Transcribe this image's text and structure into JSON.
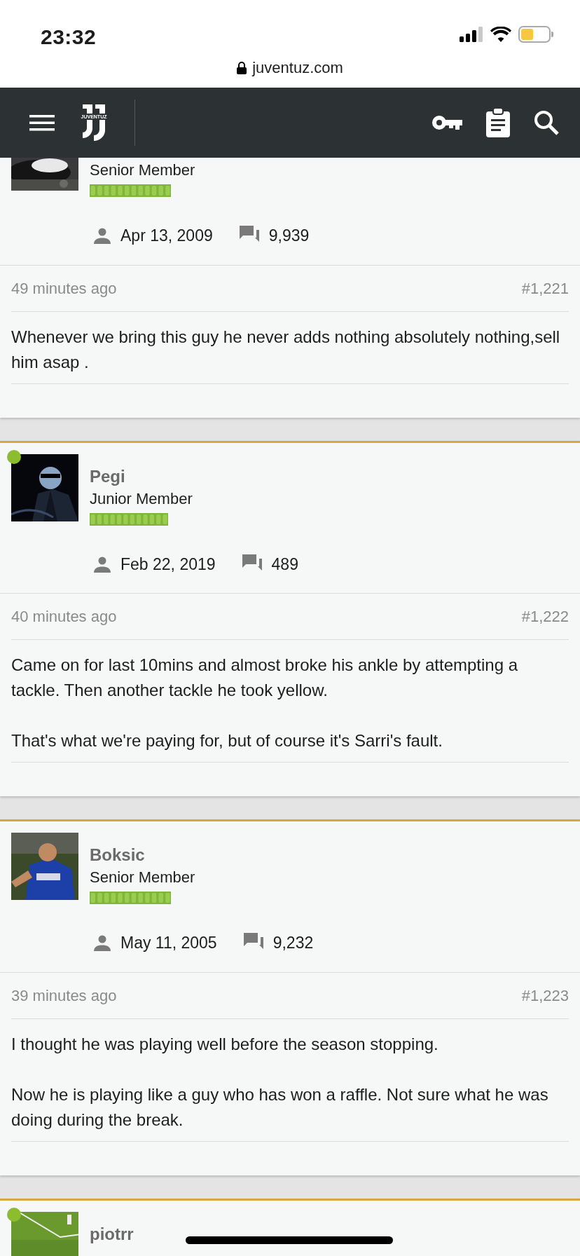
{
  "status_bar": {
    "time": "23:32"
  },
  "address_bar": {
    "url": "juventuz.com"
  },
  "navbar": {
    "logo_text": "JUVENTUZ"
  },
  "posts": [
    {
      "cut_top": true,
      "online": false,
      "role": "Senior Member",
      "joined": "Apr 13, 2009",
      "messages": "9,939",
      "time": "49 minutes ago",
      "number": "#1,221",
      "paragraphs": [
        "Whenever we bring this guy he never adds nothing absolutely nothing,sell him asap ."
      ]
    },
    {
      "cut_top": false,
      "online": true,
      "name": "Pegi",
      "role": "Junior Member",
      "joined": "Feb 22, 2019",
      "messages": "489",
      "time": "40 minutes ago",
      "number": "#1,222",
      "paragraphs": [
        "Came on for last 10mins and almost broke his ankle by attempting a tackle. Then another tackle he took yellow.",
        "That's what we're paying for, but of course it's Sarri's fault."
      ]
    },
    {
      "cut_top": false,
      "online": false,
      "name": "Boksic",
      "role": "Senior Member",
      "joined": "May 11, 2005",
      "messages": "9,232",
      "time": "39 minutes ago",
      "number": "#1,223",
      "paragraphs": [
        "I thought he was playing well before the season stopping.",
        "Now he is playing like a guy who has won a raffle. Not sure what he was doing during the break."
      ]
    },
    {
      "cut_top": false,
      "online": true,
      "name": "piotrr"
    }
  ]
}
